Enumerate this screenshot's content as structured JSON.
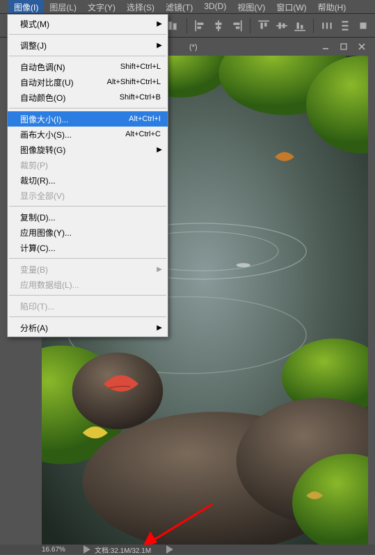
{
  "menubar": {
    "items": [
      {
        "label": "图像(I)",
        "active": true
      },
      {
        "label": "图层(L)"
      },
      {
        "label": "文字(Y)"
      },
      {
        "label": "选择(S)"
      },
      {
        "label": "滤镜(T)"
      },
      {
        "label": "3D(D)"
      },
      {
        "label": "视图(V)"
      },
      {
        "label": "窗口(W)"
      },
      {
        "label": "帮助(H)"
      }
    ]
  },
  "menu": {
    "items": [
      {
        "label": "模式(M)",
        "submenu": true
      },
      {
        "sep": true
      },
      {
        "label": "调整(J)",
        "submenu": true
      },
      {
        "sep": true
      },
      {
        "label": "自动色调(N)",
        "shortcut": "Shift+Ctrl+L"
      },
      {
        "label": "自动对比度(U)",
        "shortcut": "Alt+Shift+Ctrl+L"
      },
      {
        "label": "自动颜色(O)",
        "shortcut": "Shift+Ctrl+B"
      },
      {
        "sep": true
      },
      {
        "label": "图像大小(I)...",
        "shortcut": "Alt+Ctrl+I",
        "hi": true
      },
      {
        "label": "画布大小(S)...",
        "shortcut": "Alt+Ctrl+C"
      },
      {
        "label": "图像旋转(G)",
        "submenu": true
      },
      {
        "label": "裁剪(P)",
        "disabled": true
      },
      {
        "label": "裁切(R)..."
      },
      {
        "label": "显示全部(V)",
        "disabled": true
      },
      {
        "sep": true
      },
      {
        "label": "复制(D)..."
      },
      {
        "label": "应用图像(Y)..."
      },
      {
        "label": "计算(C)..."
      },
      {
        "sep": true
      },
      {
        "label": "变量(B)",
        "submenu": true,
        "disabled": true
      },
      {
        "label": "应用数据组(L)...",
        "disabled": true
      },
      {
        "sep": true
      },
      {
        "label": "陷印(T)...",
        "disabled": true
      },
      {
        "sep": true
      },
      {
        "label": "分析(A)",
        "submenu": true
      }
    ]
  },
  "tab": {
    "title": "(*)"
  },
  "statusbar": {
    "zoom": "16.67%",
    "doc_prefix": "文档:",
    "doc_value": "32.1M/32.1M"
  },
  "colors": {
    "menu_hi": "#2b7de1",
    "annotation": "#ff0000"
  }
}
